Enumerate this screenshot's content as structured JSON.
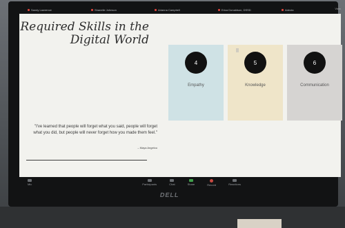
{
  "participants": [
    {
      "name": "Sandy Lawrence"
    },
    {
      "name": "Shanelle Johnson"
    },
    {
      "name": "Arianna Campbell"
    },
    {
      "name": "Erica Donaldson, DSSD"
    },
    {
      "name": "Adeola"
    }
  ],
  "view_label": "View",
  "slide": {
    "title": "Required Skills in the Digital World",
    "cards": [
      {
        "number": "4",
        "label": "Empathy",
        "color": "#cfe2e5"
      },
      {
        "number": "5",
        "label": "Knowledge",
        "color": "#efe5c9"
      },
      {
        "number": "6",
        "label": "Communication",
        "color": "#d6d4d2"
      }
    ],
    "quote": "\"I've learned that people will forget what you said, people will forget what you did, but people will never forget how you made them feel.\"",
    "attribution": "– Maya Angelou"
  },
  "toolbar": {
    "items": [
      {
        "label": "Mic"
      },
      {
        "label": "Participants"
      },
      {
        "label": "Chat"
      },
      {
        "label": "Share"
      },
      {
        "label": "Record"
      },
      {
        "label": "Reactions"
      }
    ]
  },
  "monitor_brand": "DELL"
}
